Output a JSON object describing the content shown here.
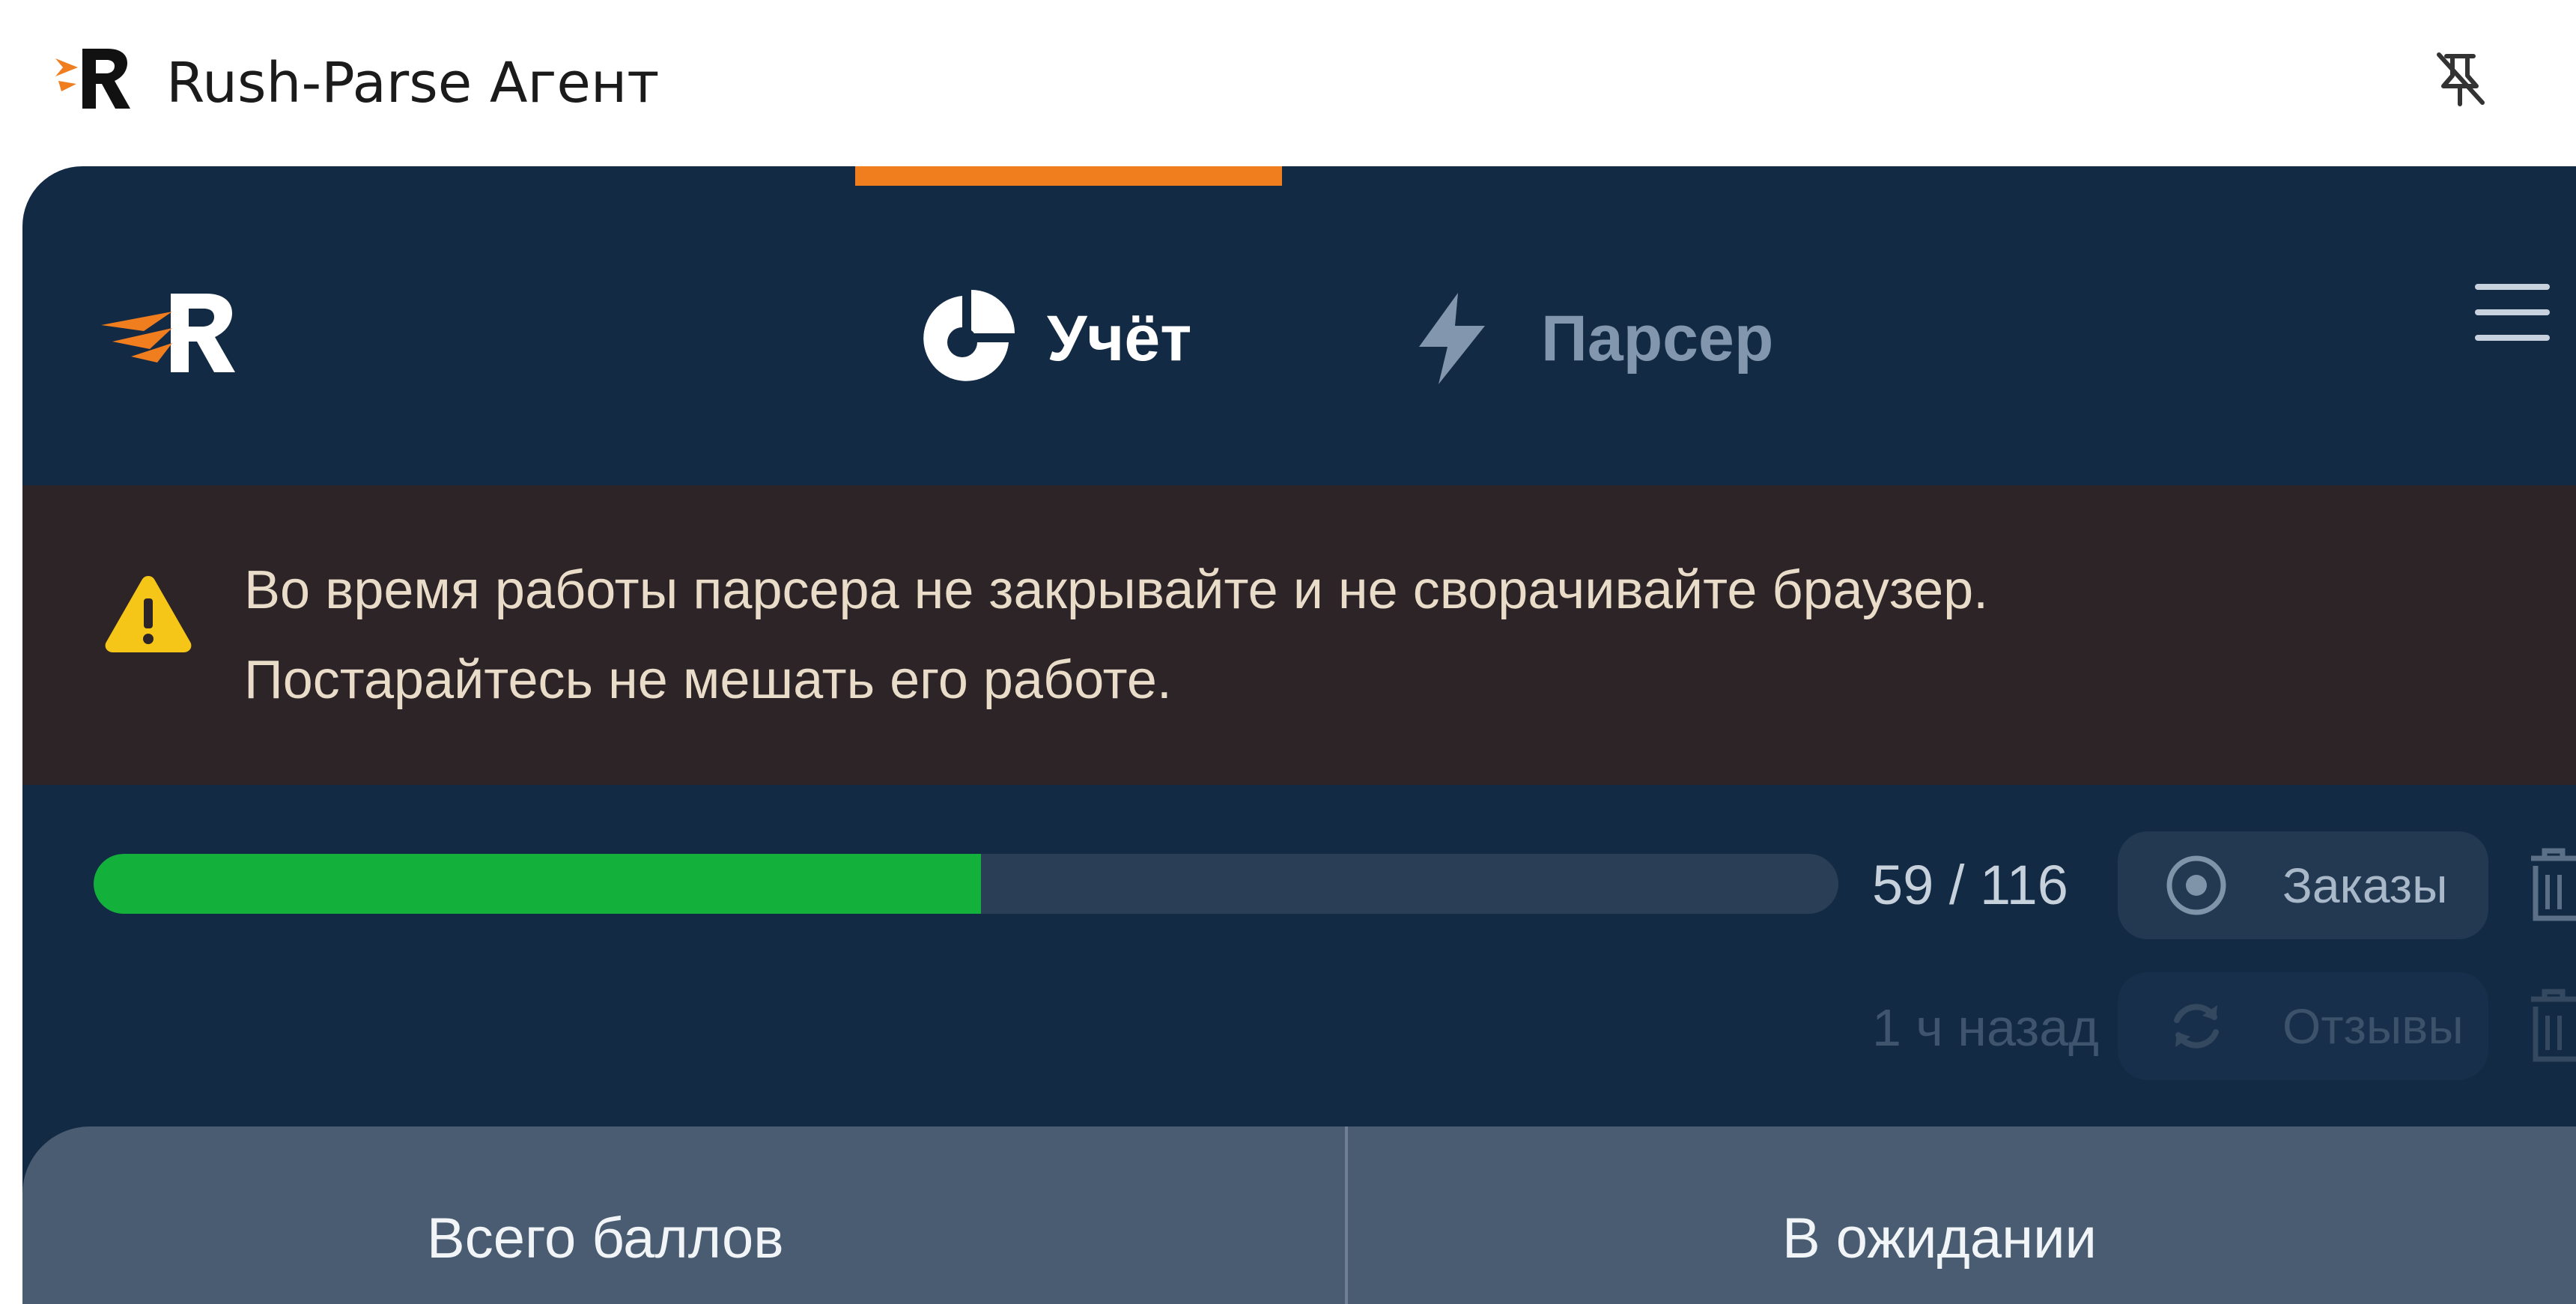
{
  "window": {
    "title": "Rush-Parse Агент",
    "app_icon": "rush-parse-logo",
    "pin_icon": "unpin-icon"
  },
  "header": {
    "logo": "rush-parse-logo",
    "tabs": [
      {
        "label": "Учёт",
        "icon": "pie-chart-icon",
        "active": true
      },
      {
        "label": "Парсер",
        "icon": "lightning-icon",
        "active": false
      }
    ],
    "menu_icon": "hamburger-menu-icon"
  },
  "warning": {
    "icon": "warning-triangle-icon",
    "line1": "Во время работы парсера не закрывайте и не сворачивайте браузер.",
    "line2": "Постарайтесь не мешать его работе."
  },
  "progress": {
    "done": 59,
    "total": 116,
    "label": "59 / 116",
    "time_ago": "1 ч назад"
  },
  "actions": {
    "orders": {
      "label": "Заказы",
      "icon": "target-icon"
    },
    "reviews": {
      "label": "Отзывы",
      "icon": "refresh-icon"
    },
    "delete_icon": "trash-icon"
  },
  "stats": {
    "total_points_label": "Всего баллов",
    "pending_label": "В ожидании"
  },
  "colors": {
    "panel_bg": "#132a44",
    "accent_orange": "#f07d1e",
    "progress_green": "#13b13b",
    "warning_bg": "#2d2428",
    "warning_yellow": "#f5c518"
  }
}
